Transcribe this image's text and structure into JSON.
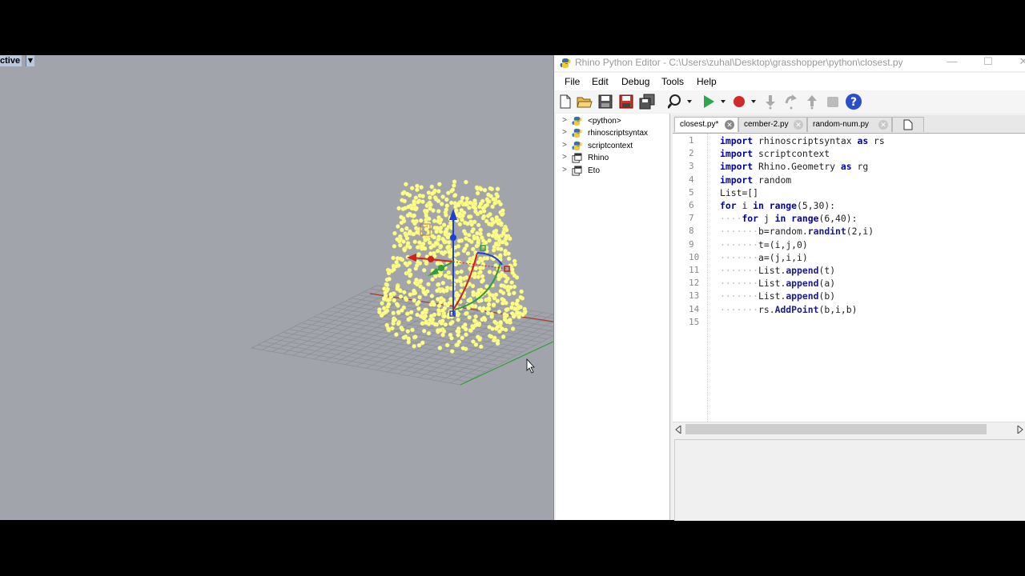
{
  "viewport": {
    "label": "ctive",
    "dropdown_glyph": "▼",
    "colors": {
      "background": "#a1a5ab",
      "points": "#ffff88",
      "x_axis": "#c0392b",
      "y_axis": "#2e9e3a",
      "z_axis": "#1f3fd6"
    }
  },
  "editor": {
    "title": "Rhino Python Editor - C:\\Users\\zuhal\\Desktop\\grasshopper\\python\\closest.py",
    "window_buttons": {
      "minimize": "—",
      "maximize": "☐",
      "close": "✕"
    },
    "menu": [
      "File",
      "Edit",
      "Debug",
      "Tools",
      "Help"
    ],
    "toolbar_icons": [
      "new-file-icon",
      "open-folder-icon",
      "save-icon",
      "save-as-icon",
      "save-all-icon",
      "find-icon",
      "run-icon",
      "breakpoint-icon",
      "step-into-icon",
      "step-over-icon",
      "step-out-icon",
      "stop-icon",
      "help-icon"
    ],
    "tree": [
      {
        "label": "<python>",
        "icon": "python-icon"
      },
      {
        "label": "rhinoscriptsyntax",
        "icon": "python-icon"
      },
      {
        "label": "scriptcontext",
        "icon": "python-icon"
      },
      {
        "label": "Rhino",
        "icon": "namespace-icon"
      },
      {
        "label": "Eto",
        "icon": "namespace-icon"
      }
    ],
    "tabs": [
      {
        "label": "closest.py*",
        "active": true
      },
      {
        "label": "cember-2.py",
        "active": false
      },
      {
        "label": "random-num.py",
        "active": false
      }
    ],
    "code": {
      "line_numbers": [
        "1",
        "2",
        "3",
        "4",
        "5",
        "6",
        "7",
        "8",
        "9",
        "10",
        "11",
        "12",
        "13",
        "14",
        "15"
      ],
      "lines": [
        "import rhinoscriptsyntax as rs",
        "import scriptcontext",
        "import Rhino.Geometry as rg",
        "import random",
        "List=[]",
        "for i in range(5,30):",
        "····for j in range(6,40):",
        "·······b=random.randint(2,i)",
        "·······t=(i,j,0)",
        "·······a=(j,i,i)",
        "·······List.append(t)",
        "·······List.append(a)",
        "·······List.append(b)",
        "·······rs.AddPoint(b,i,b)",
        ""
      ]
    }
  }
}
